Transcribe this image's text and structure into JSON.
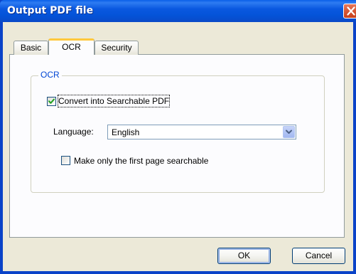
{
  "window": {
    "title": "Output PDF file"
  },
  "tabs": [
    {
      "label": "Basic",
      "active": false
    },
    {
      "label": "OCR",
      "active": true
    },
    {
      "label": "Security",
      "active": false
    }
  ],
  "ocr_group": {
    "legend": "OCR",
    "convert_checkbox": {
      "label": "Convert into Searchable PDF",
      "checked": true
    },
    "language": {
      "label": "Language:",
      "value": "English"
    },
    "first_page_checkbox": {
      "label": "Make only the first page searchable",
      "checked": false
    }
  },
  "buttons": {
    "ok": "OK",
    "cancel": "Cancel"
  },
  "colors": {
    "titlebar": "#0a58e0",
    "dialog_face": "#ece9d8",
    "legend_text": "#0046d5",
    "active_tab_accent": "#ffc83c",
    "checkmark": "#21a121"
  },
  "icons": {
    "close": "close-icon",
    "checkmark": "checkmark-icon",
    "dropdown": "chevron-down-icon"
  }
}
